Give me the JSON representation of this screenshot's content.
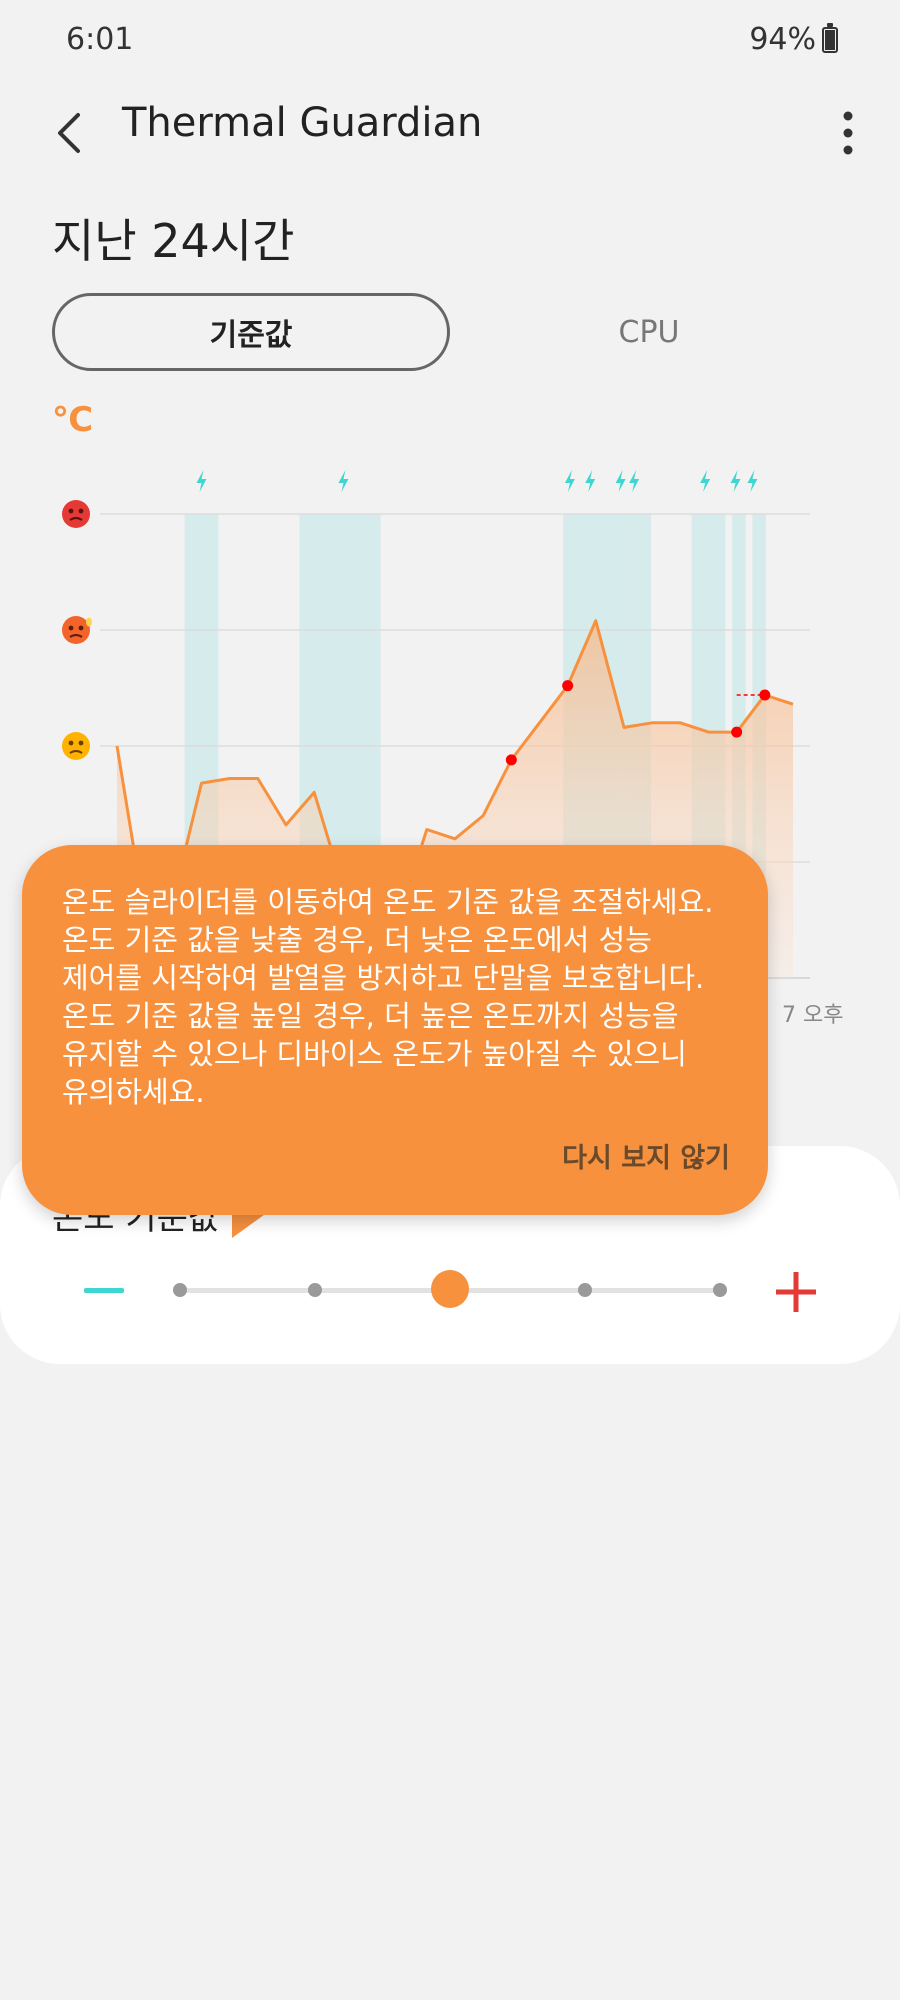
{
  "status_bar": {
    "time": "6:01",
    "battery": "94%"
  },
  "app_bar": {
    "title": "Thermal Guardian"
  },
  "section_title": "지난 24시간",
  "tabs": [
    {
      "label": "기준값",
      "active": true
    },
    {
      "label": "CPU",
      "active": false
    }
  ],
  "chart": {
    "unit": "℃",
    "x_tick_label": "7 오후",
    "y_levels": [
      "hot-face-icon",
      "overheat-face-icon",
      "worried-face-icon"
    ],
    "colors": {
      "line": "#f7913e",
      "throttle": "#bfe6e6",
      "alert": "#ff0000",
      "icon": "#3dd6d0"
    }
  },
  "chart_data": {
    "type": "area",
    "series": [
      {
        "values": [
          0.5,
          0.13,
          0.17,
          0.42,
          0.43,
          0.43,
          0.33,
          0.4,
          0.2,
          0.09,
          0.13,
          0.32,
          0.3,
          0.35,
          0.47,
          0.55,
          0.63,
          0.77,
          0.54,
          0.55,
          0.55,
          0.53,
          0.53,
          0.61,
          0.59
        ]
      }
    ],
    "alert_points": [
      14,
      16,
      22,
      23
    ],
    "throttle_periods": [
      [
        0.1,
        0.15
      ],
      [
        0.27,
        0.39
      ],
      [
        0.66,
        0.74
      ],
      [
        0.74,
        0.76
      ],
      [
        0.76,
        0.79
      ],
      [
        0.85,
        0.9
      ],
      [
        0.91,
        0.93
      ],
      [
        0.94,
        0.96
      ]
    ],
    "lightning_markers": [
      0.125,
      0.335,
      0.67,
      0.7,
      0.745,
      0.765,
      0.87,
      0.915,
      0.94
    ]
  },
  "tooltip": {
    "lines": [
      "온도 슬라이더를 이동하여 온도 기준 값을 조절하세요.",
      "온도 기준 값을 낮출 경우, 더 낮은 온도에서 성능",
      "제어를 시작하여 발열을 방지하고 단말을 보호합니다.",
      "온도 기준 값을 높일 경우, 더 높은 온도까지 성능을",
      "유지할 수 있으나 디바이스 온도가 높아질 수 있으니",
      "유의하세요."
    ],
    "dismiss_label": "다시 보지 않기"
  },
  "threshold": {
    "label": "온도 기준값",
    "steps": 5,
    "current_step": 3
  }
}
